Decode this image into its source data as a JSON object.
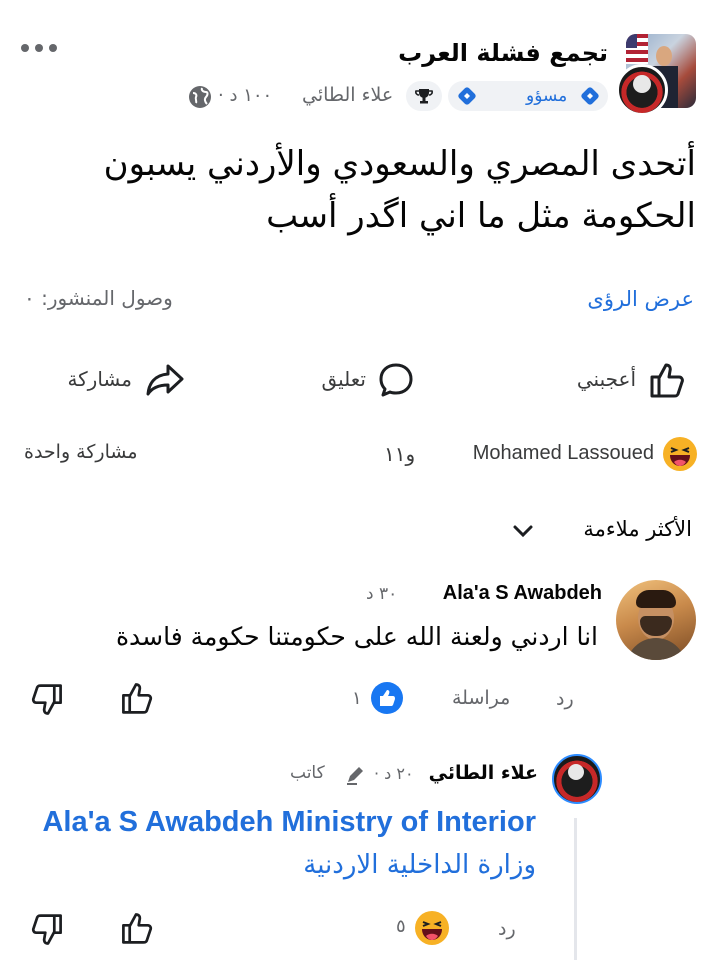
{
  "post": {
    "group_name": "تجمع فشلة العرب",
    "author": "علاء الطائي",
    "time": "١٠٠ د ·",
    "badge_label": "مسؤو",
    "text_line1": "أتحدى المصري والسعودي والأردني يسبون",
    "text_line2": "الحكومة مثل ما اني اگدر أسب",
    "view_insights": "عرض الرؤى",
    "reach": "وصول المنشور: ٠"
  },
  "actions": {
    "like": "أعجبني",
    "comment": "تعليق",
    "share": "مشاركة"
  },
  "reactions": {
    "names": "Mohamed Lassoued",
    "others": "و١١",
    "shares": "مشاركة واحدة"
  },
  "sort": {
    "label": "الأكثر ملاءمة"
  },
  "comment1": {
    "author": "Ala'a S Awabdeh",
    "time": "٣٠ د",
    "text": "انا اردني ولعنة الله على حكومتنا  حكومة فاسدة",
    "reply": "رد",
    "message": "مراسلة",
    "like_count": "١"
  },
  "comment2": {
    "author": "علاء الطائي",
    "time": "٢٠ د ·",
    "role": "كاتب",
    "text_en": "Ala'a S Awabdeh Ministry of Interior",
    "text_ar": "وزارة الداخلية الاردنية",
    "reply": "رد",
    "reaction_count": "٥"
  },
  "colors": {
    "accent": "#216fdb",
    "muted": "#65676b",
    "like_blue": "#1877f2",
    "haha_yellow": "#f7b125"
  }
}
